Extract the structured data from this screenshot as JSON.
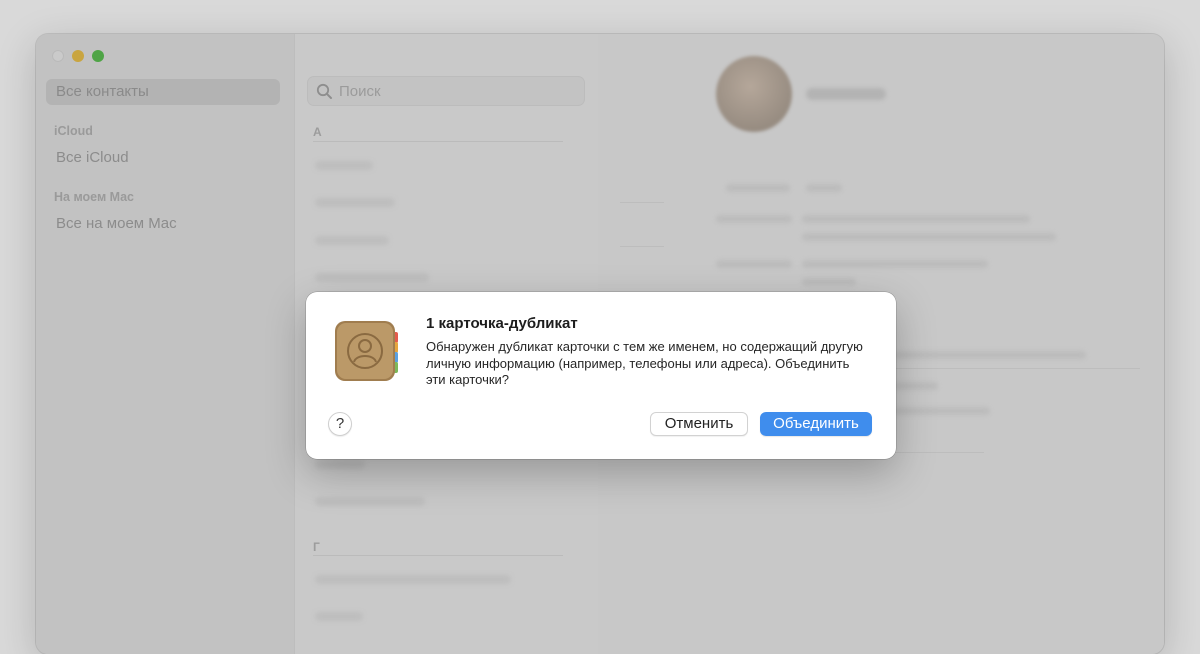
{
  "sidebar": {
    "all_contacts": "Все контакты",
    "icloud_header": "iCloud",
    "all_icloud": "Все iCloud",
    "on_mac_header": "На моем Mac",
    "all_on_mac": "Все на моем Mac"
  },
  "contacts_list": {
    "search_placeholder": "Поиск",
    "section_a": "А",
    "section_g": "Г"
  },
  "dialog": {
    "title": "1 карточка-дубликат",
    "message": "Обнаружен дубликат карточки с тем же именем, но содержащий другую личную информацию (например, телефоны или адреса). Объединить эти карточки?",
    "help_label": "?",
    "cancel_label": "Отменить",
    "merge_label": "Объединить"
  },
  "colors": {
    "accent": "#3f8ded",
    "traffic_min": "#c9a540",
    "traffic_max": "#4fa446"
  },
  "icons": {
    "search": "search-icon",
    "app": "contacts-app-icon"
  }
}
